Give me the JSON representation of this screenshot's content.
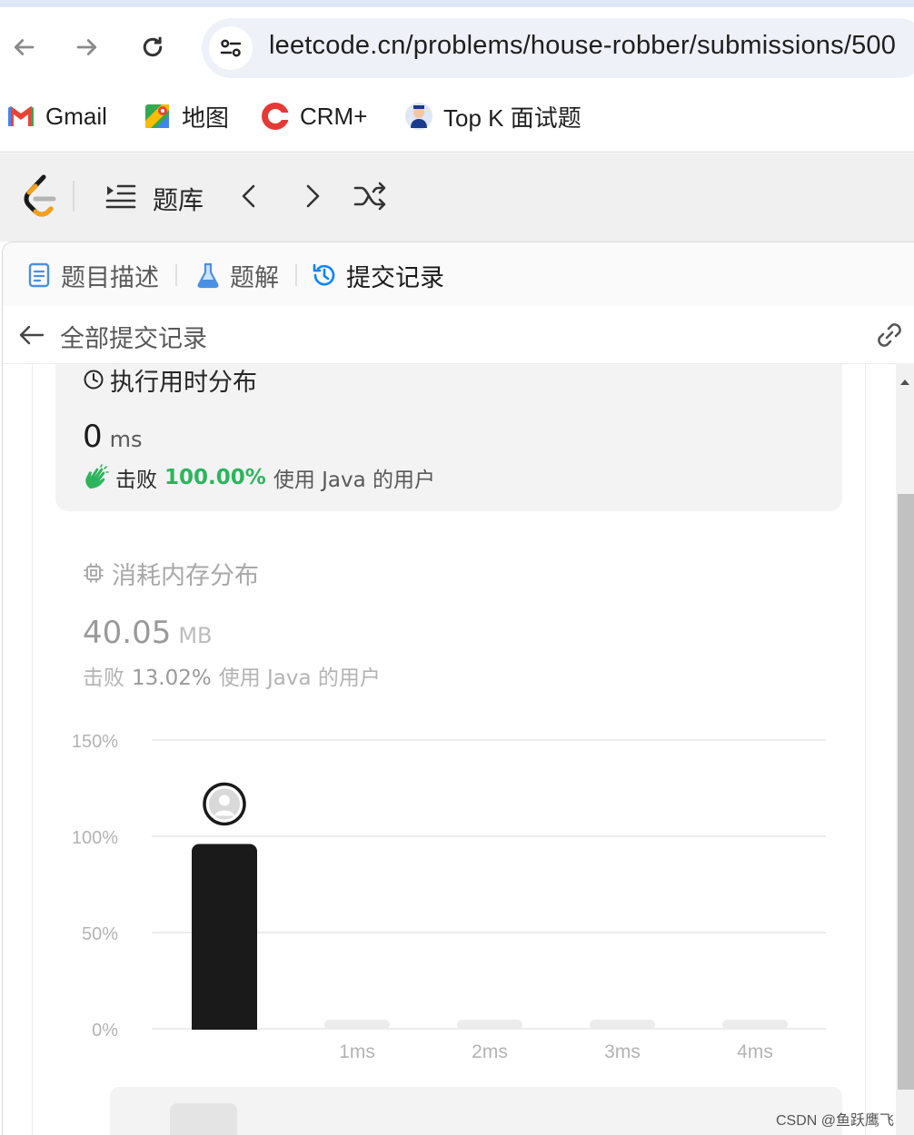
{
  "browser": {
    "url": "leetcode.cn/problems/house-robber/submissions/500",
    "back_icon": "arrow-left-icon",
    "forward_icon": "arrow-right-icon",
    "reload_icon": "reload-icon",
    "site_settings_icon": "tune-icon",
    "bookmarks": [
      {
        "label": "Gmail",
        "icon": "gmail-icon",
        "color": "#d93025"
      },
      {
        "label": "地图",
        "icon": "maps-icon",
        "color": "#34a853"
      },
      {
        "label": "CRM+",
        "icon": "crm-icon",
        "color": "#e53935"
      },
      {
        "label": "Top K 面试题",
        "icon": "topk-icon",
        "color": "#1a3a8c"
      }
    ]
  },
  "header": {
    "logo": "leetcode-logo",
    "problem_list_label": "题库",
    "prev_icon": "chevron-left-icon",
    "next_icon": "chevron-right-icon",
    "shuffle_icon": "shuffle-icon"
  },
  "tabs": [
    {
      "label": "题目描述",
      "icon": "description-icon",
      "color": "#3b82f6",
      "active": false
    },
    {
      "label": "题解",
      "icon": "flask-icon",
      "color": "#3b82f6",
      "active": false
    },
    {
      "label": "提交记录",
      "icon": "history-icon",
      "color": "#0a84ff",
      "active": true
    }
  ],
  "subheader": {
    "title": "全部提交记录",
    "back_icon": "arrow-left-icon",
    "link_icon": "link-icon"
  },
  "runtime": {
    "title": "执行用时分布",
    "value": "0",
    "unit": "ms",
    "beat_prefix": "击败",
    "beat_percent": "100.00%",
    "beat_suffix": "使用 Java 的用户"
  },
  "memory": {
    "title": "消耗内存分布",
    "value": "40.05",
    "unit": "MB",
    "beat_prefix": "击败",
    "beat_percent": "13.02%",
    "beat_suffix": "使用 Java 的用户"
  },
  "chart_data": {
    "type": "bar",
    "categories": [
      "",
      "1ms",
      "2ms",
      "3ms",
      "4ms"
    ],
    "values": [
      96,
      0,
      0,
      0,
      0
    ],
    "highlighted_index": 0,
    "y_ticks": [
      "0%",
      "50%",
      "100%",
      "150%"
    ],
    "ylim": [
      0,
      150
    ],
    "xlabel": "",
    "ylabel": "",
    "grid": true,
    "colors": {
      "highlight": "#1a1a1a",
      "other": "#ececec",
      "grid": "#e6e6e6",
      "tick": "#b3b3b3"
    }
  },
  "watermark": "CSDN @鱼跃鹰飞"
}
